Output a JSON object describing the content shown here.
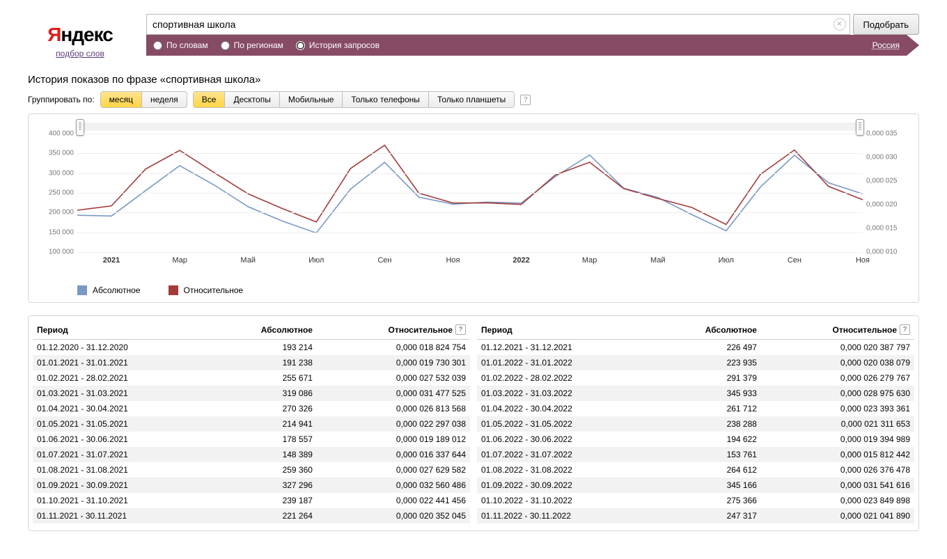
{
  "logo": {
    "y": "Я",
    "rest": "ндекс",
    "sub": "подбор слов"
  },
  "search": {
    "value": "спортивная школа",
    "submit": "Подобрать"
  },
  "tabs": {
    "words": "По словам",
    "regions": "По регионам",
    "history": "История запросов",
    "region": "Россия"
  },
  "title": "История показов по фразе «спортивная школа»",
  "group_label": "Группировать по:",
  "group": {
    "month": "месяц",
    "week": "неделя"
  },
  "device": {
    "all": "Все",
    "desktop": "Десктопы",
    "mobile": "Мобильные",
    "phones": "Только телефоны",
    "tablets": "Только планшеты"
  },
  "legend": {
    "abs": "Абсолютное",
    "rel": "Относительное"
  },
  "colors": {
    "abs": "#7a98c6",
    "rel": "#a33b3b"
  },
  "table_headers": {
    "period": "Период",
    "abs": "Абсолютное",
    "rel": "Относительное"
  },
  "chart_data": {
    "type": "line",
    "title": "",
    "xlabel": "",
    "ylabel_left": "Абсолютное",
    "ylabel_right": "Относительное",
    "ylim_left": [
      100000,
      400000
    ],
    "ylim_right": [
      1e-05,
      3.5e-05
    ],
    "x_ticks": [
      "2021",
      "Мар",
      "Май",
      "Июл",
      "Сен",
      "Ноя",
      "2022",
      "Мар",
      "Май",
      "Июл",
      "Сен",
      "Ноя"
    ],
    "categories": [
      "2020-12",
      "2021-01",
      "2021-02",
      "2021-03",
      "2021-04",
      "2021-05",
      "2021-06",
      "2021-07",
      "2021-08",
      "2021-09",
      "2021-10",
      "2021-11",
      "2021-12",
      "2022-01",
      "2022-02",
      "2022-03",
      "2022-04",
      "2022-05",
      "2022-06",
      "2022-07",
      "2022-08",
      "2022-09",
      "2022-10",
      "2022-11"
    ],
    "series": [
      {
        "name": "Абсолютное",
        "axis": "left",
        "color": "#7a98c6",
        "values": [
          193214,
          191238,
          255671,
          319086,
          270326,
          214941,
          178557,
          148389,
          259360,
          327296,
          239187,
          221264,
          226497,
          223935,
          291379,
          345933,
          261712,
          238288,
          194622,
          153761,
          264612,
          345166,
          275366,
          247317
        ]
      },
      {
        "name": "Относительное",
        "axis": "right",
        "color": "#a33b3b",
        "values": [
          1.8824754e-05,
          1.9730301e-05,
          2.7532039e-05,
          3.1477525e-05,
          2.6813568e-05,
          2.2297038e-05,
          1.9189012e-05,
          1.6337644e-05,
          2.7629582e-05,
          3.2560486e-05,
          2.2441456e-05,
          2.0352045e-05,
          2.0387797e-05,
          2.0038079e-05,
          2.6279767e-05,
          2.897563e-05,
          2.3393361e-05,
          2.1311653e-05,
          1.9394989e-05,
          1.5812442e-05,
          2.6376478e-05,
          3.1541616e-05,
          2.3849898e-05,
          2.104189e-05
        ]
      }
    ]
  },
  "left_ticks": [
    "400 000",
    "350 000",
    "300 000",
    "250 000",
    "200 000",
    "150 000",
    "100 000"
  ],
  "right_ticks": [
    "0,000 035",
    "0,000 030",
    "0,000 025",
    "0,000 020",
    "0,000 015",
    "0,000 010"
  ],
  "table_left": [
    {
      "period": "01.12.2020 - 31.12.2020",
      "abs": "193 214",
      "rel": "0,000 018 824 754"
    },
    {
      "period": "01.01.2021 - 31.01.2021",
      "abs": "191 238",
      "rel": "0,000 019 730 301"
    },
    {
      "period": "01.02.2021 - 28.02.2021",
      "abs": "255 671",
      "rel": "0,000 027 532 039"
    },
    {
      "period": "01.03.2021 - 31.03.2021",
      "abs": "319 086",
      "rel": "0,000 031 477 525"
    },
    {
      "period": "01.04.2021 - 30.04.2021",
      "abs": "270 326",
      "rel": "0,000 026 813 568"
    },
    {
      "period": "01.05.2021 - 31.05.2021",
      "abs": "214 941",
      "rel": "0,000 022 297 038"
    },
    {
      "period": "01.06.2021 - 30.06.2021",
      "abs": "178 557",
      "rel": "0,000 019 189 012"
    },
    {
      "period": "01.07.2021 - 31.07.2021",
      "abs": "148 389",
      "rel": "0,000 016 337 644"
    },
    {
      "period": "01.08.2021 - 31.08.2021",
      "abs": "259 360",
      "rel": "0,000 027 629 582"
    },
    {
      "period": "01.09.2021 - 30.09.2021",
      "abs": "327 296",
      "rel": "0,000 032 560 486"
    },
    {
      "period": "01.10.2021 - 31.10.2021",
      "abs": "239 187",
      "rel": "0,000 022 441 456"
    },
    {
      "period": "01.11.2021 - 30.11.2021",
      "abs": "221 264",
      "rel": "0,000 020 352 045"
    }
  ],
  "table_right": [
    {
      "period": "01.12.2021 - 31.12.2021",
      "abs": "226 497",
      "rel": "0,000 020 387 797"
    },
    {
      "period": "01.01.2022 - 31.01.2022",
      "abs": "223 935",
      "rel": "0,000 020 038 079"
    },
    {
      "period": "01.02.2022 - 28.02.2022",
      "abs": "291 379",
      "rel": "0,000 026 279 767"
    },
    {
      "period": "01.03.2022 - 31.03.2022",
      "abs": "345 933",
      "rel": "0,000 028 975 630"
    },
    {
      "period": "01.04.2022 - 30.04.2022",
      "abs": "261 712",
      "rel": "0,000 023 393 361"
    },
    {
      "period": "01.05.2022 - 31.05.2022",
      "abs": "238 288",
      "rel": "0,000 021 311 653"
    },
    {
      "period": "01.06.2022 - 30.06.2022",
      "abs": "194 622",
      "rel": "0,000 019 394 989"
    },
    {
      "period": "01.07.2022 - 31.07.2022",
      "abs": "153 761",
      "rel": "0,000 015 812 442"
    },
    {
      "period": "01.08.2022 - 31.08.2022",
      "abs": "264 612",
      "rel": "0,000 026 376 478"
    },
    {
      "period": "01.09.2022 - 30.09.2022",
      "abs": "345 166",
      "rel": "0,000 031 541 616"
    },
    {
      "period": "01.10.2022 - 31.10.2022",
      "abs": "275 366",
      "rel": "0,000 023 849 898"
    },
    {
      "period": "01.11.2022 - 30.11.2022",
      "abs": "247 317",
      "rel": "0,000 021 041 890"
    }
  ]
}
